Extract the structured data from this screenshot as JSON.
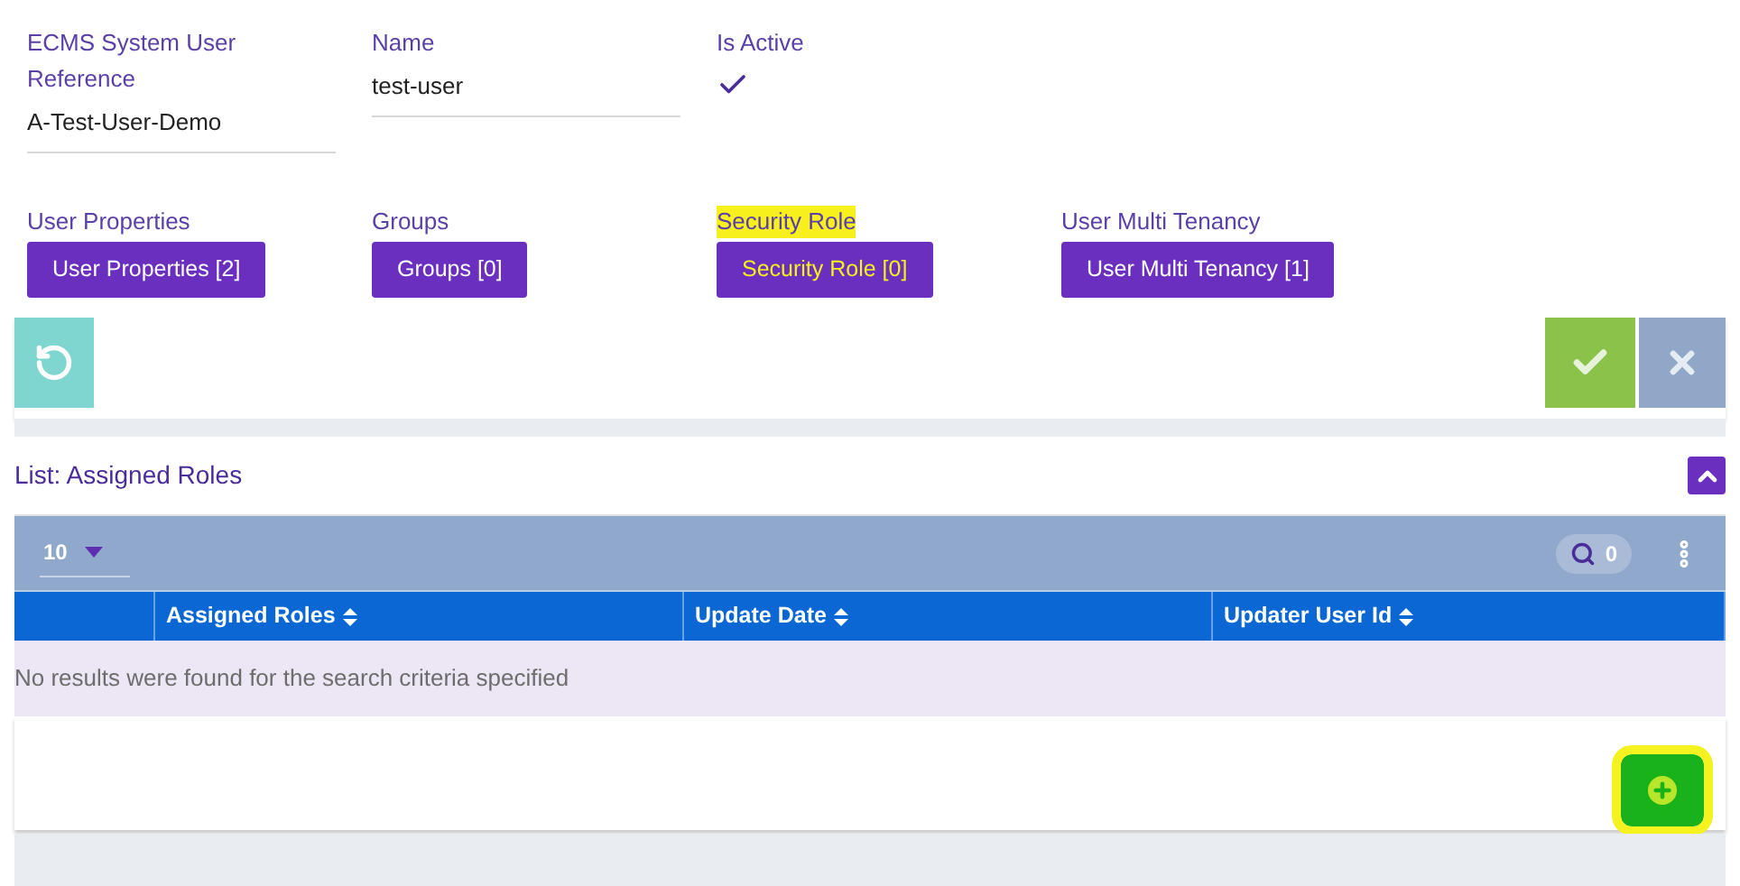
{
  "fields": [
    {
      "kind": "text",
      "label": "ECMS System User Reference",
      "value": "A-Test-User-Demo"
    },
    {
      "kind": "text",
      "label": "Name",
      "value": "test-user"
    },
    {
      "kind": "check",
      "label": "Is Active",
      "checked": true
    }
  ],
  "links": [
    {
      "label": "User Properties",
      "button": "User Properties [2]",
      "highlighted": false
    },
    {
      "label": "Groups",
      "button": "Groups [0]",
      "highlighted": false
    },
    {
      "label": "Security Role",
      "button": "Security Role [0]",
      "highlighted": true
    },
    {
      "label": "User Multi Tenancy",
      "button": "User Multi Tenancy [1]",
      "highlighted": false
    }
  ],
  "list": {
    "title": "List: Assigned Roles",
    "expanded": true,
    "page_size": "10",
    "search_count": "0",
    "columns": [
      "Assigned Roles",
      "Update Date",
      "Updater User Id"
    ],
    "empty_message": "No results were found for the search criteria specified",
    "add_highlighted": true
  }
}
